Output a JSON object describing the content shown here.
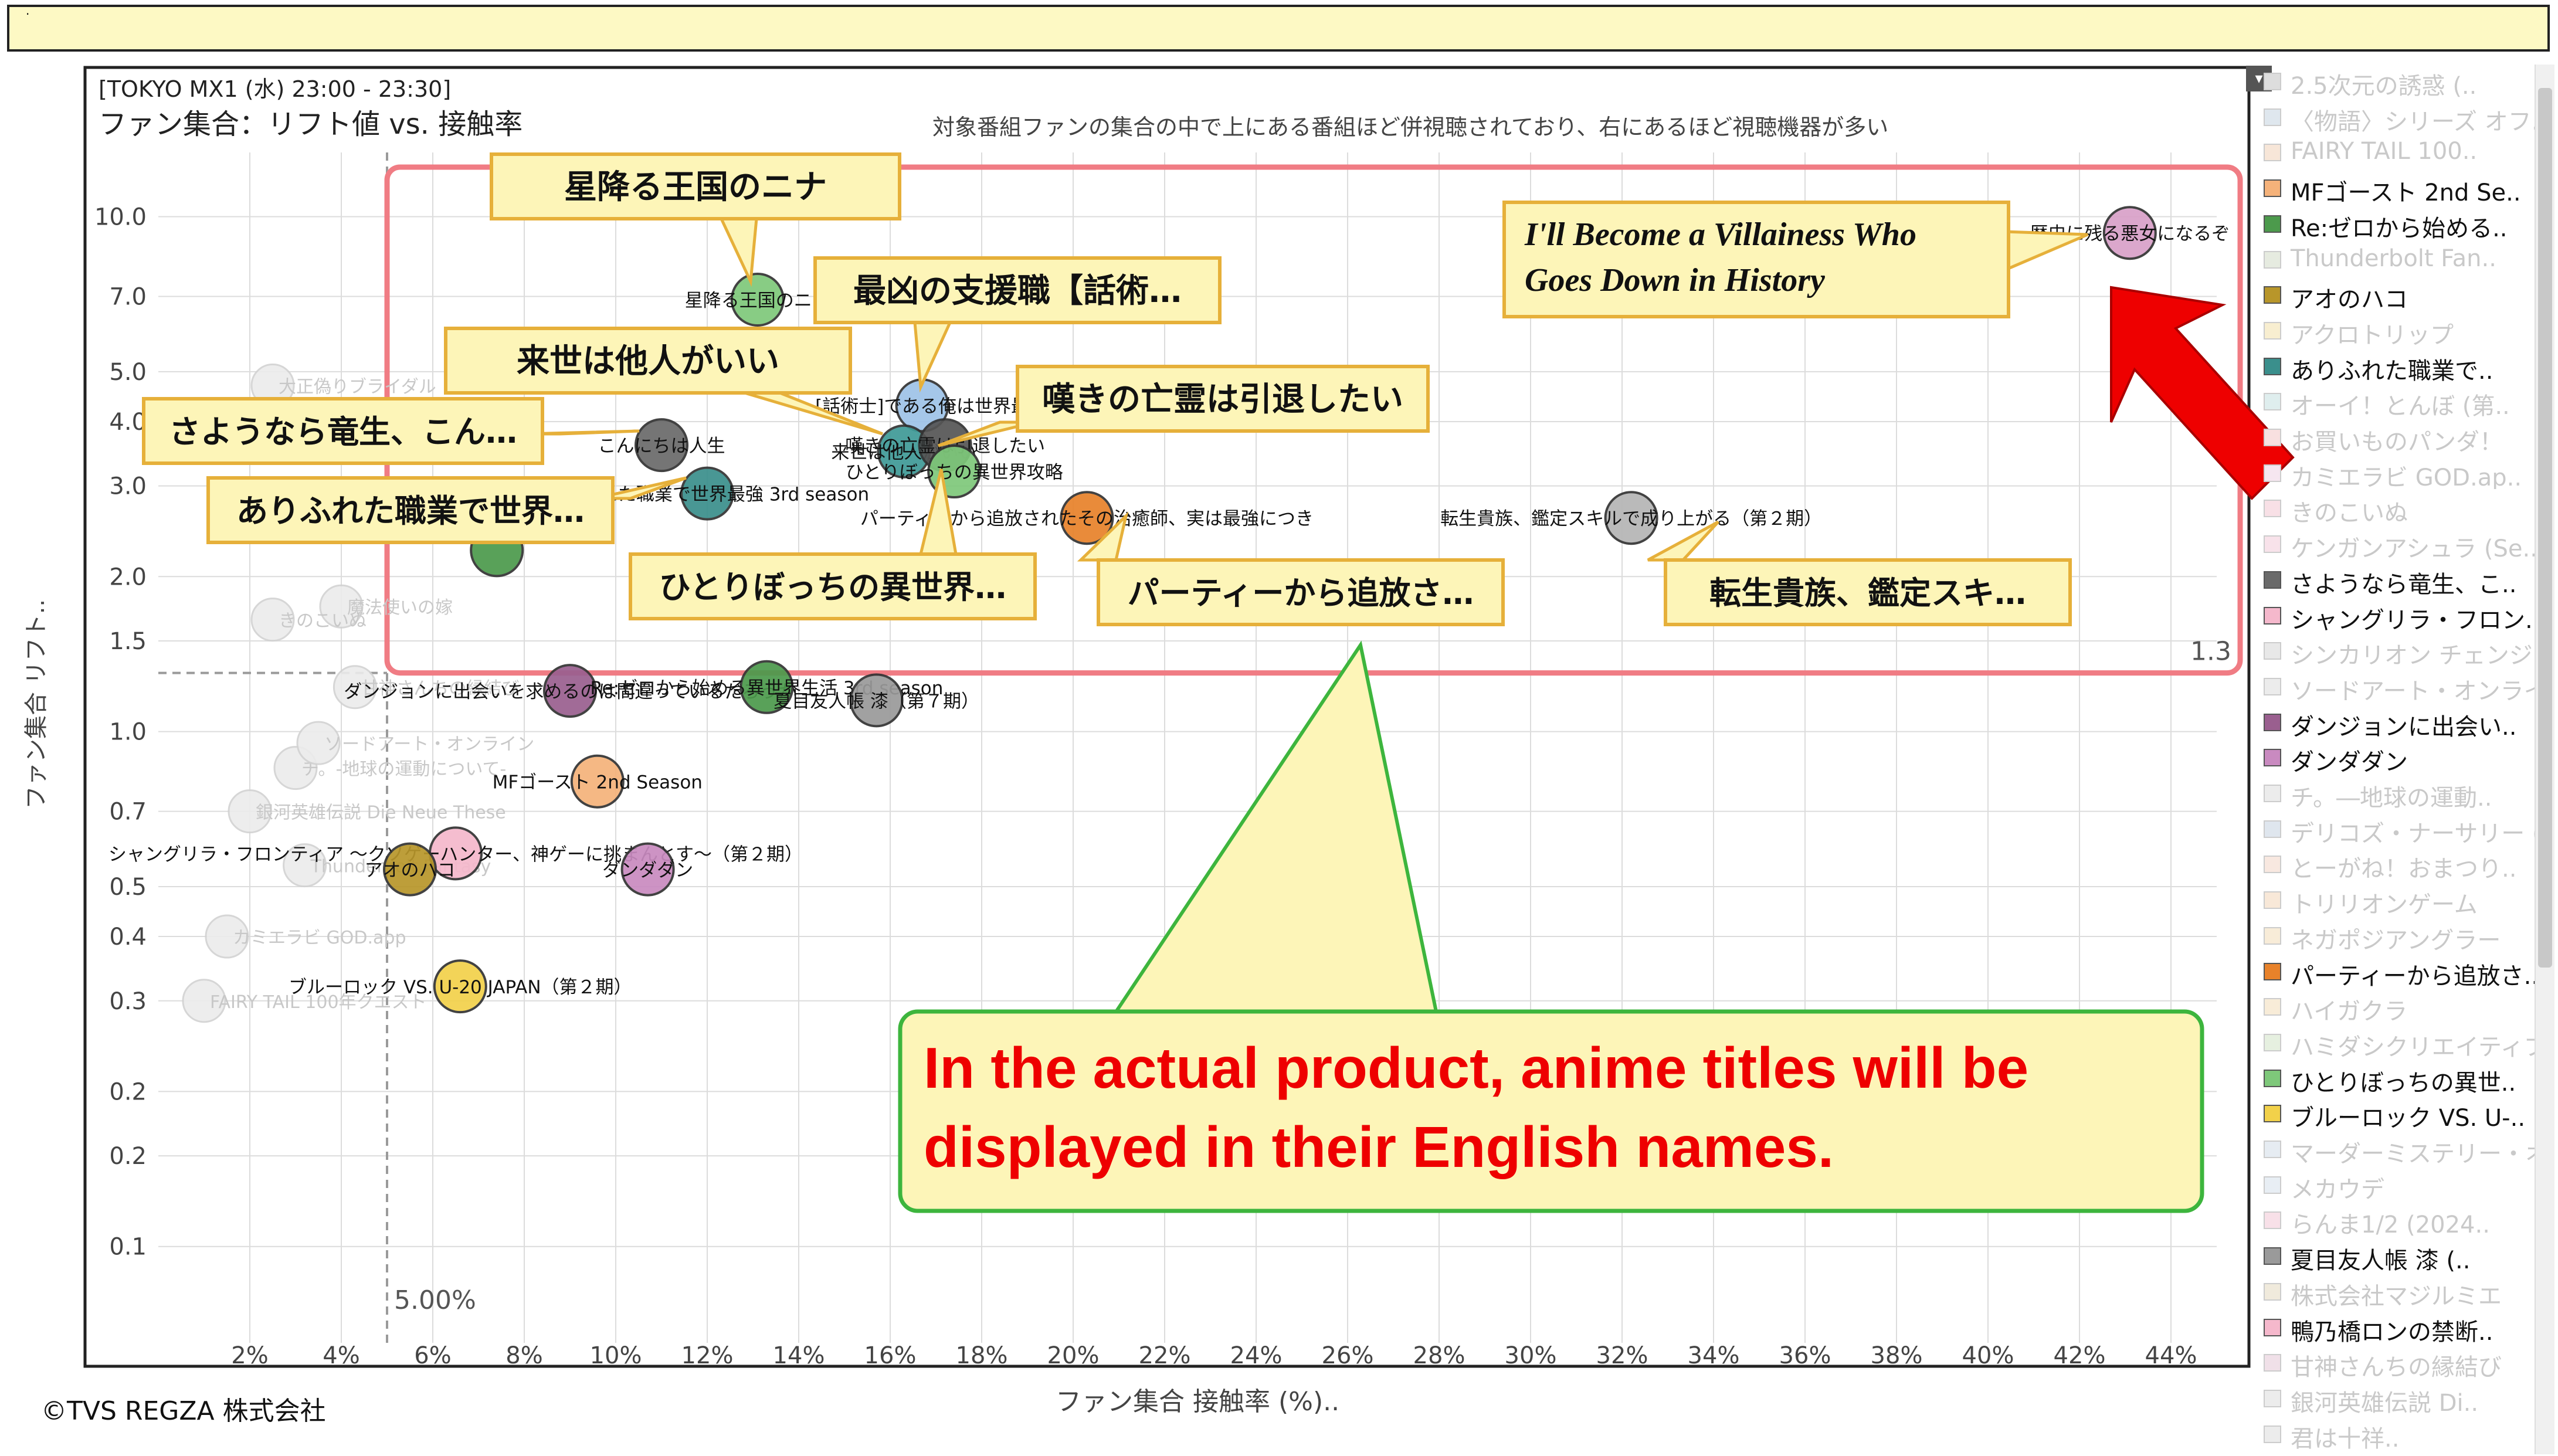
{
  "topbar": {
    "text": "·"
  },
  "dropdown": {
    "glyph": "▾"
  },
  "copyright": "©TVS REGZA 株式会社",
  "chart_data": {
    "type": "scatter",
    "subtitle_top": "[TOKYO MX1 (水) 23:00 - 23:30]",
    "title": "ファン集合：リフト値 vs. 接触率",
    "caption": "対象番組ファンの集合の中で上にある番組ほど併視聴されており、右にあるほど視聴機器が多い",
    "xlabel": "ファン集合 接触率 (%)..",
    "ylabel": "ファン集合 リフト..",
    "x_scale": "linear",
    "y_scale": "log",
    "xlim": [
      0,
      45
    ],
    "ylim": [
      0.065,
      12
    ],
    "xticks": [
      "2%",
      "4%",
      "6%",
      "8%",
      "10%",
      "12%",
      "14%",
      "16%",
      "18%",
      "20%",
      "22%",
      "24%",
      "26%",
      "28%",
      "30%",
      "32%",
      "34%",
      "36%",
      "38%",
      "40%",
      "42%",
      "44%"
    ],
    "xtick_values": [
      2,
      4,
      6,
      8,
      10,
      12,
      14,
      16,
      18,
      20,
      22,
      24,
      26,
      28,
      30,
      32,
      34,
      36,
      38,
      40,
      42,
      44
    ],
    "yticks": [
      "10.0",
      "7.0",
      "5.0",
      "4.0",
      "3.0",
      "2.0",
      "1.5",
      "1.0",
      "0.7",
      "0.5",
      "0.4",
      "0.3",
      "0.2",
      "0.2",
      "0.1"
    ],
    "ytick_values": [
      10,
      7,
      5,
      4,
      3,
      2,
      1.5,
      1,
      0.7,
      0.5,
      0.4,
      0.3,
      0.2,
      0.15,
      0.1
    ],
    "ref_x": 5.0,
    "ref_x_label": "5.00%",
    "ref_y": 1.3,
    "ref_y_label": "1.3",
    "grid": true,
    "legend_position": "right",
    "points": [
      {
        "label": "歴史に残る悪女になるぞ",
        "x": 43.1,
        "y": 9.3,
        "color": "#d8a0c8"
      },
      {
        "label": "星降る王国のニナ",
        "x": 13.1,
        "y": 6.9,
        "color": "#7ec87a"
      },
      {
        "label": "[話術士]である俺は世界最",
        "x": 16.7,
        "y": 4.3,
        "color": "#9ec3e8"
      },
      {
        "label": "来世は他人がいい",
        "x": 16.3,
        "y": 3.5,
        "color": "#3e9a96"
      },
      {
        "label": "嘆きの亡霊は引退したい",
        "x": 17.2,
        "y": 3.6,
        "color": "#555555"
      },
      {
        "label": "こんにちは人生",
        "x": 11.0,
        "y": 3.6,
        "color": "#6a6a6a"
      },
      {
        "label": "ありふれた職業で世界最強 3rd season",
        "x": 12.0,
        "y": 2.9,
        "color": "#3a8f8c"
      },
      {
        "label": "ひとりぼっちの異世界攻略",
        "x": 17.4,
        "y": 3.2,
        "color": "#7ec87a"
      },
      {
        "label": "パーティーから追放されたその治癒師、実は最強につき",
        "x": 20.3,
        "y": 2.6,
        "color": "#e8822a"
      },
      {
        "label": "転生貴族、鑑定スキルで成り上がる（第２期）",
        "x": 32.2,
        "y": 2.6,
        "color": "#b5b5b5"
      },
      {
        "label": "ダンジョンに出会いを求めるのは間違っているだろうか",
        "x": 9.0,
        "y": 1.2,
        "color": "#9a5f8f"
      },
      {
        "label": "Re:ゼロから始める異世界生活 3rd season",
        "x": 13.3,
        "y": 1.22,
        "color": "#4c9a4c"
      },
      {
        "label": "夏目友人帳 漆（第７期）",
        "x": 15.7,
        "y": 1.15,
        "color": "#9a9a9a"
      },
      {
        "label": "MFゴースト 2nd Season",
        "x": 9.6,
        "y": 0.8,
        "color": "#f5b27a"
      },
      {
        "label": "シャングリラ・フロンティア ～クソゲーハンター、神ゲーに挑まんとす～（第２期）",
        "x": 6.5,
        "y": 0.58,
        "color": "#f5b8cc"
      },
      {
        "label": "ダンダダン",
        "x": 10.7,
        "y": 0.54,
        "color": "#c98ac0"
      },
      {
        "label": "アオのハコ",
        "x": 5.5,
        "y": 0.54,
        "color": "#b8962a"
      },
      {
        "label": "ブルーロック VS. U-20 JAPAN（第２期）",
        "x": 6.6,
        "y": 0.32,
        "color": "#f2d14a"
      },
      {
        "label": "",
        "x": 7.4,
        "y": 2.25,
        "color": "#4c9a4c"
      }
    ],
    "faded_points": [
      {
        "label": "大正偽りブライダル　身代わり花嫁",
        "x": 2.5,
        "y": 4.7
      },
      {
        "label": "魔法使いの嫁",
        "x": 4.0,
        "y": 1.75
      },
      {
        "label": "きのこいぬ",
        "x": 2.5,
        "y": 1.65
      },
      {
        "label": "チ。-地球の運動について-",
        "x": 3.0,
        "y": 0.85
      },
      {
        "label": "Thunderbolt Fantasy",
        "x": 3.2,
        "y": 0.55
      },
      {
        "label": "FAIRY TAIL 100年クエスト",
        "x": 1.0,
        "y": 0.3
      },
      {
        "label": "銀河英雄伝説 Die Neue These",
        "x": 2.0,
        "y": 0.7
      },
      {
        "label": "カミエラビ GOD.app",
        "x": 1.5,
        "y": 0.4
      },
      {
        "label": "ソードアート・オンライン",
        "x": 3.5,
        "y": 0.95
      },
      {
        "label": "甘神さんちの縁結び",
        "x": 4.3,
        "y": 1.22
      }
    ],
    "annotations": [
      {
        "text": "星降る王国のニナ",
        "style": "box-jp"
      },
      {
        "text": "最凶の支援職【話術…",
        "style": "box-jp"
      },
      {
        "text": "来世は他人がいい",
        "style": "box-jp"
      },
      {
        "text": "嘆きの亡霊は引退したい",
        "style": "box-jp"
      },
      {
        "text": "さようなら竜生、こん…",
        "style": "box-jp"
      },
      {
        "text": "ありふれた職業で世界…",
        "style": "box-jp"
      },
      {
        "text": "ひとりぼっちの異世界…",
        "style": "box-jp"
      },
      {
        "text": "パーティーから追放さ…",
        "style": "box-jp"
      },
      {
        "text": "転生貴族、鑑定スキ…",
        "style": "box-jp"
      },
      {
        "text": "I'll Become a Villainess Who Goes Down in History",
        "style": "box-en"
      },
      {
        "text": "In the actual product, anime titles will be displayed in their English names.",
        "style": "callout"
      }
    ]
  },
  "legend": {
    "items": [
      {
        "label": "2.5次元の誘惑 (..",
        "color": "#dddddd",
        "faded": true
      },
      {
        "label": "〈物語〉シリーズ オフ..",
        "color": "#dfe7ee",
        "faded": true
      },
      {
        "label": "FAIRY TAIL 100..",
        "color": "#f7e6d8",
        "faded": true
      },
      {
        "label": "MFゴースト 2nd Se..",
        "color": "#f5b27a",
        "faded": false
      },
      {
        "label": "Re:ゼロから始める..",
        "color": "#4c9a4c",
        "faded": false
      },
      {
        "label": "Thunderbolt Fan..",
        "color": "#e6ebe0",
        "faded": true
      },
      {
        "label": "アオのハコ",
        "color": "#b8962a",
        "faded": false
      },
      {
        "label": "アクロトリップ",
        "color": "#f8eed0",
        "faded": true
      },
      {
        "label": "ありふれた職業で..",
        "color": "#3a8f8c",
        "faded": false
      },
      {
        "label": "オーイ！とんぼ (第..",
        "color": "#dfeeee",
        "faded": true
      },
      {
        "label": "お買いものパンダ！",
        "color": "#f8e0e0",
        "faded": true
      },
      {
        "label": "カミエラビ GOD.ap..",
        "color": "#f6e6f0",
        "faded": true
      },
      {
        "label": "きのこいぬ",
        "color": "#f8e0e6",
        "faded": true
      },
      {
        "label": "ケンガンアシュラ (Se..",
        "color": "#f8e2ea",
        "faded": true
      },
      {
        "label": "さようなら竜生、こ..",
        "color": "#6a6a6a",
        "faded": false
      },
      {
        "label": "シャングリラ・フロン..",
        "color": "#f5b8cc",
        "faded": false
      },
      {
        "label": "シンカリオン チェンジ..",
        "color": "#e8e8e8",
        "faded": true
      },
      {
        "label": "ソードアート・オンライ..",
        "color": "#ececec",
        "faded": true
      },
      {
        "label": "ダンジョンに出会い..",
        "color": "#9a5f8f",
        "faded": false
      },
      {
        "label": "ダンダダン",
        "color": "#c98ac0",
        "faded": false
      },
      {
        "label": "チ。―地球の運動..",
        "color": "#ececec",
        "faded": true
      },
      {
        "label": "デリコズ・ナーサリー (..",
        "color": "#dfe6ee",
        "faded": true
      },
      {
        "label": "とーがね！おまつり..",
        "color": "#f8e8e0",
        "faded": true
      },
      {
        "label": "トリリオンゲーム",
        "color": "#f8e8d8",
        "faded": true
      },
      {
        "label": "ネガポジアングラー",
        "color": "#f8ecd8",
        "faded": true
      },
      {
        "label": "パーティーから追放さ..",
        "color": "#e8822a",
        "faded": false
      },
      {
        "label": "ハイガクラ",
        "color": "#f8ecd8",
        "faded": true
      },
      {
        "label": "ハミダシクリエイティブ",
        "color": "#e6f0e0",
        "faded": true
      },
      {
        "label": "ひとりぼっちの異世..",
        "color": "#7ec87a",
        "faded": false
      },
      {
        "label": "ブルーロック VS. U-..",
        "color": "#f2d14a",
        "faded": false
      },
      {
        "label": "マーダーミステリー・オ..",
        "color": "#e6ecf2",
        "faded": true
      },
      {
        "label": "メカウデ",
        "color": "#e8eef4",
        "faded": true
      },
      {
        "label": "らんま1/2 (2024..",
        "color": "#f8e0e8",
        "faded": true
      },
      {
        "label": "夏目友人帳 漆 (..",
        "color": "#9a9a9a",
        "faded": false
      },
      {
        "label": "株式会社マジルミエ",
        "color": "#f0eadc",
        "faded": true
      },
      {
        "label": "鴨乃橋ロンの禁断..",
        "color": "#f5b8cc",
        "faded": false
      },
      {
        "label": "甘神さんちの縁結び",
        "color": "#f0e0e8",
        "faded": true
      },
      {
        "label": "銀河英雄伝説 Di..",
        "color": "#ececec",
        "faded": true
      },
      {
        "label": "君は十祥..",
        "color": "#ececec",
        "faded": true
      }
    ]
  }
}
